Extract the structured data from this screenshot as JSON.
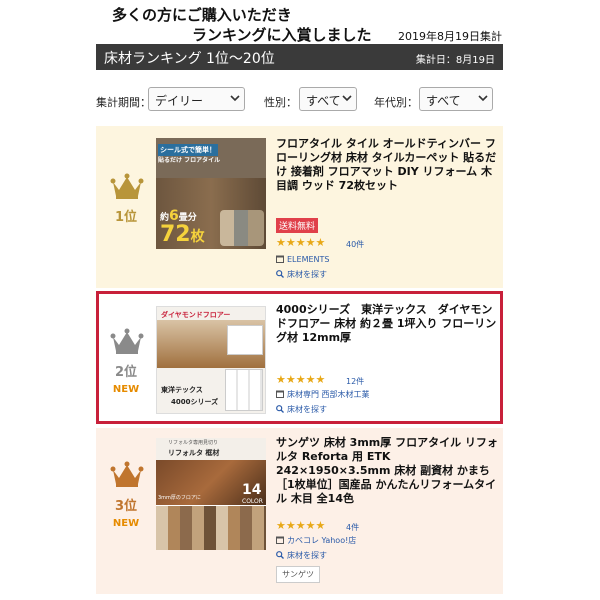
{
  "header": {
    "line1": "多くの方にご購入いただき",
    "line2": "ランキングに入賞しました",
    "date": "2019年8月19日集計"
  },
  "bar": {
    "title": "床材ランキング 1位〜20位",
    "date": "集計日：8月19日"
  },
  "filters": [
    {
      "label": "集計期間：",
      "value": "デイリー"
    },
    {
      "label": "性別：",
      "value": "すべて"
    },
    {
      "label": "年代別：",
      "value": "すべて"
    }
  ],
  "items": [
    {
      "rank": "1位",
      "title": "フロアタイル タイル オールドティンバー フローリング材 床材 タイルカーペット 貼るだけ 接着剤 フロアマット DIY リフォーム 木目調 ウッド 72枚セット",
      "badge": "送料無料",
      "stars": "★★★★★",
      "count": "40件",
      "shop": "ELEMENTS",
      "link": "床材を探す",
      "thumb": {
        "caption1": "シール式で簡単！",
        "caption2": "貼るだけ フロアタイル",
        "t1": "約",
        "t2": "6",
        "t3": "畳分",
        "big": "72",
        "unit": "枚"
      }
    },
    {
      "rank": "2位",
      "new": "NEW",
      "title": "4000シリーズ　東洋テックス　ダイヤモンドフロアー 床材 約２畳 1坪入り フローリング材 12mm厚",
      "stars": "★★★★★",
      "count": "12件",
      "shop": "床材専門 西部木材工業",
      "link": "床材を探す",
      "thumb": {
        "head": "ダイヤモンドフロアー",
        "maker": "東洋テックス",
        "series": "4000シリーズ"
      }
    },
    {
      "rank": "3位",
      "new": "NEW",
      "title": "サンゲツ 床材 3mm厚 フロアタイル リフォルタ Reforta 用 ETK 242×1950×3.5mm 床材 副資材 かまち［1枚単位］国産品 かんたんリフォームタイル 木目 全14色",
      "stars": "★★★★★",
      "count": "4件",
      "shop": "カベコレ Yahoo!店",
      "link": "床材を探す",
      "tag": "サンゲツ",
      "thumb": {
        "top": "リフォルタ専用見切り",
        "name": "リフォルタ 框材",
        "num": "14",
        "color": "COLOR",
        "sub": "3mm厚のフロアに"
      }
    }
  ],
  "colors": {
    "crown_gold": "#b8953a",
    "crown_silver": "#8a8a8a",
    "crown_bronze": "#c0752e",
    "new": "#e68b00",
    "highlight_border": "#c8203a",
    "star": "#e8a817",
    "link": "#2a5aa8"
  }
}
